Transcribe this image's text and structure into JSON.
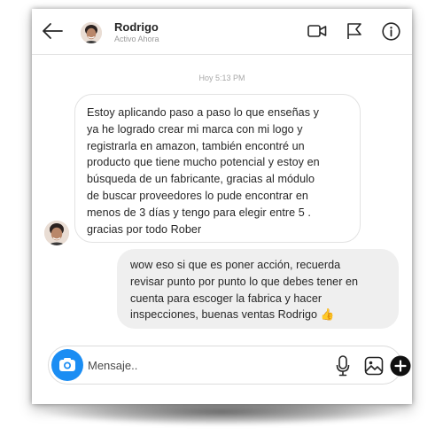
{
  "header": {
    "contact_name": "Rodrigo",
    "status": "Activo Ahora",
    "icons": [
      "back-arrow-icon",
      "video-camera-icon",
      "flag-icon",
      "info-icon"
    ]
  },
  "conversation": {
    "timestamp": "Hoy 5:13 PM",
    "messages": [
      {
        "direction": "incoming",
        "text": "Estoy aplicando paso a paso lo que enseñas y\nya he logrado crear mi marca con mi logo y\nregistrarla en amazon, también encontré un\nproducto que tiene mucho potencial y estoy en\nbúsqueda de un fabricante, gracias al módulo\nde buscar proveedores lo pude encontrar en\nmenos de 3 días y tengo para elegir entre 5 .\ngracias por todo Rober"
      },
      {
        "direction": "outgoing",
        "text": "wow eso si que es poner acción, recuerda\nrevisar punto por punto lo que debes tener en\ncuenta para escoger la fabrica y hacer\ninspecciones, buenas ventas Rodrigo 👍"
      }
    ]
  },
  "composer": {
    "placeholder": "Mensaje..",
    "value": "",
    "icons": [
      "camera-icon",
      "microphone-icon",
      "image-icon",
      "plus-icon"
    ]
  },
  "colors": {
    "accent": "#1b8df3",
    "outgoing_bubble": "#efefef",
    "incoming_border": "#e2e2e2"
  }
}
